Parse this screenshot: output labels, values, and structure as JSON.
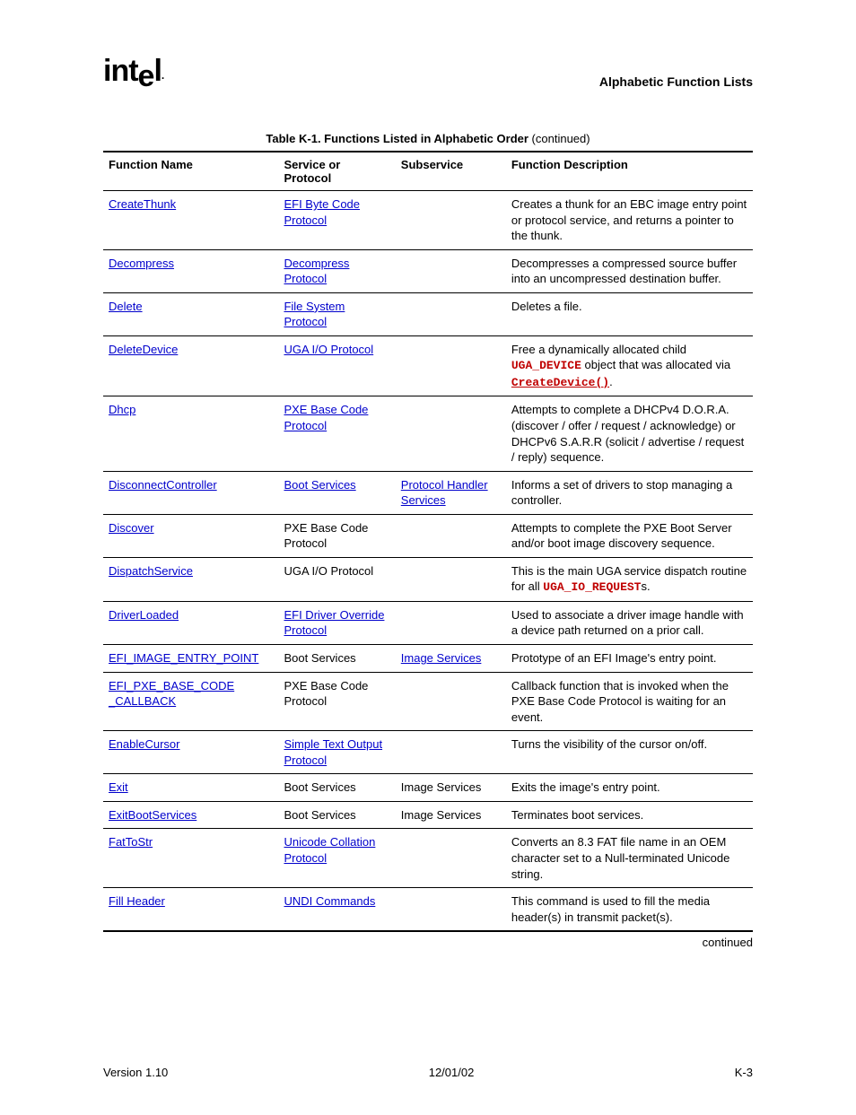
{
  "header": {
    "logo_text": "intel",
    "doc_title": "Alphabetic Function Lists"
  },
  "table": {
    "caption_bold": "Table K-1.  Functions Listed in Alphabetic Order",
    "caption_tail": " (continued)",
    "columns": {
      "c0": "Function Name",
      "c1": "Service or Protocol",
      "c2": "Subservice",
      "c3": "Function Description"
    },
    "rows": [
      {
        "name": {
          "text": "CreateThunk",
          "link": true
        },
        "svc": {
          "text": "EFI Byte Code Protocol",
          "link": true
        },
        "sub": {
          "text": "",
          "link": false
        },
        "desc_parts": [
          {
            "t": "Creates a thunk for an EBC image entry point or protocol service, and returns a pointer to the thunk."
          }
        ]
      },
      {
        "name": {
          "text": "Decompress",
          "link": true
        },
        "svc": {
          "text": "Decompress Protocol",
          "link": true
        },
        "sub": {
          "text": "",
          "link": false
        },
        "desc_parts": [
          {
            "t": "Decompresses a compressed source buffer into an uncompressed destination buffer."
          }
        ]
      },
      {
        "name": {
          "text": "Delete",
          "link": true
        },
        "svc": {
          "text": "File System Protocol",
          "link": true
        },
        "sub": {
          "text": "",
          "link": false
        },
        "desc_parts": [
          {
            "t": "Deletes a file."
          }
        ]
      },
      {
        "name": {
          "text": "DeleteDevice",
          "link": true
        },
        "svc": {
          "text": "UGA I/O Protocol",
          "link": true
        },
        "sub": {
          "text": "",
          "link": false
        },
        "desc_parts": [
          {
            "t": "Free a dynamically allocated child "
          },
          {
            "t": "UGA_DEVICE",
            "code": true
          },
          {
            "t": " object that was allocated via "
          },
          {
            "t": "CreateDevice()",
            "code": true,
            "link": true
          },
          {
            "t": "."
          }
        ]
      },
      {
        "name": {
          "text": "Dhcp",
          "link": true
        },
        "svc": {
          "text": "PXE Base Code Protocol",
          "link": true
        },
        "sub": {
          "text": "",
          "link": false
        },
        "desc_parts": [
          {
            "t": "Attempts to complete a DHCPv4 D.O.R.A. (discover / offer / request / acknowledge) or DHCPv6 S.A.R.R (solicit / advertise / request / reply) sequence."
          }
        ]
      },
      {
        "name": {
          "text": "DisconnectController",
          "link": true
        },
        "svc": {
          "text": "Boot Services",
          "link": true
        },
        "sub": {
          "text": "Protocol Handler Services",
          "link": true
        },
        "desc_parts": [
          {
            "t": "Informs a set of drivers to stop managing a controller."
          }
        ]
      },
      {
        "name": {
          "text": "Discover",
          "link": true
        },
        "svc": {
          "text": "PXE Base Code Protocol",
          "link": false
        },
        "sub": {
          "text": "",
          "link": false
        },
        "desc_parts": [
          {
            "t": "Attempts to complete the PXE Boot Server and/or boot image discovery sequence."
          }
        ]
      },
      {
        "name": {
          "text": "DispatchService",
          "link": true
        },
        "svc": {
          "text": "UGA I/O Protocol",
          "link": false
        },
        "sub": {
          "text": "",
          "link": false
        },
        "desc_parts": [
          {
            "t": "This is the main UGA service dispatch routine for all "
          },
          {
            "t": "UGA_IO_REQUEST",
            "code": true
          },
          {
            "t": "s."
          }
        ]
      },
      {
        "name": {
          "text": "DriverLoaded",
          "link": true
        },
        "svc": {
          "text": "EFI Driver Override Protocol",
          "link": true
        },
        "sub": {
          "text": "",
          "link": false
        },
        "desc_parts": [
          {
            "t": "Used to associate a driver image handle with a device path returned on a prior call."
          }
        ]
      },
      {
        "name": {
          "text": "EFI_IMAGE_ENTRY_POINT",
          "link": true
        },
        "svc": {
          "text": "Boot Services",
          "link": false
        },
        "sub": {
          "text": "Image Services",
          "link": true
        },
        "desc_parts": [
          {
            "t": "Prototype of an EFI Image's entry point."
          }
        ]
      },
      {
        "name": {
          "text": "EFI_PXE_BASE_CODE _CALLBACK",
          "link": true
        },
        "svc": {
          "text": "PXE Base Code Protocol",
          "link": false
        },
        "sub": {
          "text": "",
          "link": false
        },
        "desc_parts": [
          {
            "t": "Callback function that is invoked when the PXE Base Code Protocol is waiting for an event."
          }
        ]
      },
      {
        "name": {
          "text": "EnableCursor",
          "link": true
        },
        "svc": {
          "text": "Simple Text Output Protocol",
          "link": true
        },
        "sub": {
          "text": "",
          "link": false
        },
        "desc_parts": [
          {
            "t": "Turns the visibility of the cursor on/off."
          }
        ]
      },
      {
        "name": {
          "text": "Exit",
          "link": true
        },
        "svc": {
          "text": "Boot Services",
          "link": false
        },
        "sub": {
          "text": "Image Services",
          "link": false
        },
        "desc_parts": [
          {
            "t": "Exits the image's entry point."
          }
        ]
      },
      {
        "name": {
          "text": "ExitBootServices",
          "link": true
        },
        "svc": {
          "text": "Boot Services",
          "link": false
        },
        "sub": {
          "text": "Image Services",
          "link": false
        },
        "desc_parts": [
          {
            "t": "Terminates boot services."
          }
        ]
      },
      {
        "name": {
          "text": "FatToStr",
          "link": true
        },
        "svc": {
          "text": "Unicode Collation Protocol",
          "link": true
        },
        "sub": {
          "text": "",
          "link": false
        },
        "desc_parts": [
          {
            "t": "Converts an 8.3 FAT file name in an OEM character set to a Null-terminated Unicode string."
          }
        ]
      },
      {
        "name": {
          "text": "Fill Header",
          "link": true
        },
        "svc": {
          "text": "UNDI Commands",
          "link": true
        },
        "sub": {
          "text": "",
          "link": false
        },
        "desc_parts": [
          {
            "t": "This command is used to fill the media header(s) in transmit packet(s)."
          }
        ]
      }
    ],
    "continued_label": "continued"
  },
  "footer": {
    "version": "Version 1.10",
    "date": "12/01/02",
    "page": "K-3"
  }
}
